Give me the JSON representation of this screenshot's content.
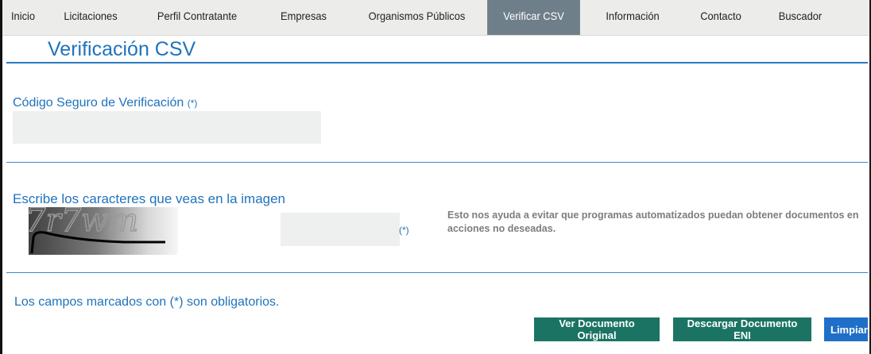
{
  "nav": {
    "items": [
      {
        "label": "Inicio"
      },
      {
        "label": "Licitaciones"
      },
      {
        "label": "Perfil Contratante"
      },
      {
        "label": "Empresas"
      },
      {
        "label": "Organismos Públicos"
      },
      {
        "label": "Verificar CSV",
        "active": true
      },
      {
        "label": "Información"
      },
      {
        "label": "Contacto"
      },
      {
        "label": "Buscador"
      }
    ]
  },
  "page": {
    "title": "Verificación CSV"
  },
  "csv": {
    "label": "Código Seguro de Verificación",
    "required_mark": "(*)",
    "value": ""
  },
  "captcha": {
    "label": "Escribe los caracteres que veas en la imagen",
    "image_text": "7r7wm",
    "value": "",
    "required_mark": "(*)",
    "help_text": "Esto nos ayuda a evitar que programas automatizados puedan obtener documentos en acciones no deseadas."
  },
  "footer": {
    "note": "Los campos marcados con (*) son obligatorios."
  },
  "buttons": {
    "view_original": "Ver Documento Original",
    "download_eni": "Descargar Documento ENI",
    "clear": "Limpiar"
  },
  "colors": {
    "accent_blue": "#1f73bd",
    "nav_active": "#6f7f8a",
    "button_green": "#1b7463",
    "button_blue": "#1f6fc8"
  }
}
